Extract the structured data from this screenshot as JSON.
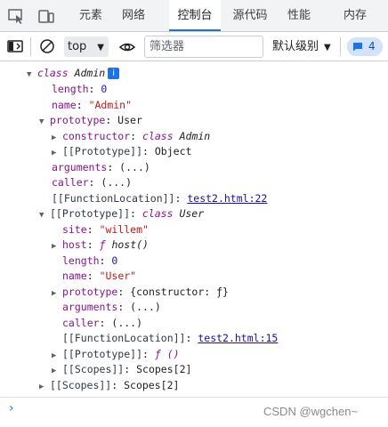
{
  "tabs": [
    {
      "label": "元素"
    },
    {
      "label": "网络"
    },
    {
      "label": "控制台"
    },
    {
      "label": "源代码"
    },
    {
      "label": "性能"
    },
    {
      "label": "内存"
    }
  ],
  "toolbar": {
    "context": "top",
    "filter_placeholder": "筛选器",
    "levels": "默认级别",
    "issues_count": "4"
  },
  "tree": {
    "root_kw": "class",
    "root_name": "Admin",
    "root_badge": "i",
    "length_key": "length",
    "length_val": "0",
    "name_key": "name",
    "name_val": "\"Admin\"",
    "prototype_key": "prototype",
    "prototype_val": "User",
    "constructor_key": "constructor",
    "constructor_kw": "class",
    "constructor_name": "Admin",
    "proto_inner_key": "[[Prototype]]",
    "proto_inner_val": "Object",
    "arguments_key": "arguments",
    "arguments_val": "(...)",
    "caller_key": "caller",
    "caller_val": "(...)",
    "fnloc_key": "[[FunctionLocation]]",
    "fnloc_link": "test2.html:22",
    "proto_key": "[[Prototype]]",
    "proto_kw": "class",
    "proto_name": "User",
    "site_key": "site",
    "site_val": "\"willem\"",
    "host_key": "host",
    "host_kw": "ƒ",
    "host_name": "host()",
    "ulength_key": "length",
    "ulength_val": "0",
    "uname_key": "name",
    "uname_val": "\"User\"",
    "uprototype_key": "prototype",
    "uprototype_val": "{constructor: ƒ}",
    "uarguments_key": "arguments",
    "uarguments_val": "(...)",
    "ucaller_key": "caller",
    "ucaller_val": "(...)",
    "ufnloc_key": "[[FunctionLocation]]",
    "ufnloc_link": "test2.html:15",
    "uproto_key": "[[Prototype]]",
    "uproto_val": "ƒ ()",
    "uscopes_key": "[[Scopes]]",
    "uscopes_val": "Scopes[2]",
    "scopes_key": "[[Scopes]]",
    "scopes_val": "Scopes[2]"
  },
  "prompt": {
    "symbol": "›"
  },
  "watermark": "CSDN @wgchen~",
  "colors": {
    "accent": "#1a73e8",
    "key": "#881391",
    "string": "#c41a16",
    "number": "#1a1aa6"
  }
}
